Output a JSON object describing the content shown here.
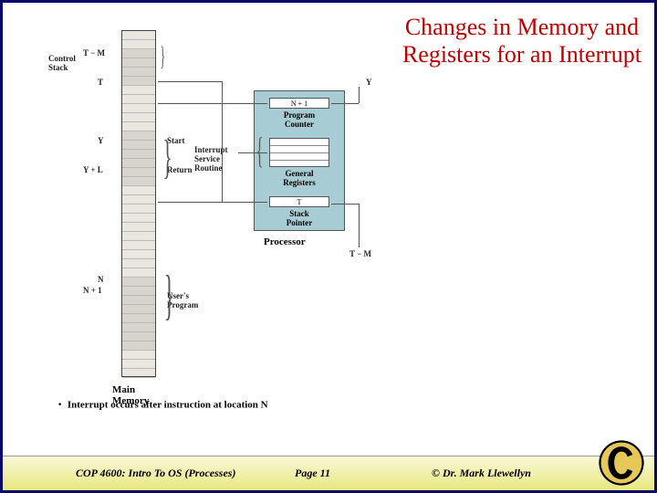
{
  "title": "Changes in Memory and Registers for an Interrupt",
  "mem": {
    "title": "Main\nMemory",
    "labels": {
      "tm": "T − M",
      "t": "T",
      "y": "Y",
      "yl": "Y + L",
      "n": "N",
      "n1": "N + 1"
    },
    "side": {
      "control": "Control\nStack",
      "start": "Start",
      "ret": "Return",
      "isr": "Interrupt\nService\nRoutine",
      "user": "User's\nProgram"
    }
  },
  "proc": {
    "title": "Processor",
    "pc": {
      "val": "N + 1",
      "label": "Program\nCounter"
    },
    "gen": {
      "label": "General\nRegisters"
    },
    "sp": {
      "val": "T",
      "label": "Stack\nPointer"
    },
    "y": "Y",
    "tm": "T − M"
  },
  "caption": "Interrupt occurs after instruction at location N",
  "bullet": "·",
  "footer": {
    "course": "COP 4600: Intro To OS  (Processes)",
    "page": "Page 11",
    "copy": "© Dr. Mark Llewellyn"
  }
}
